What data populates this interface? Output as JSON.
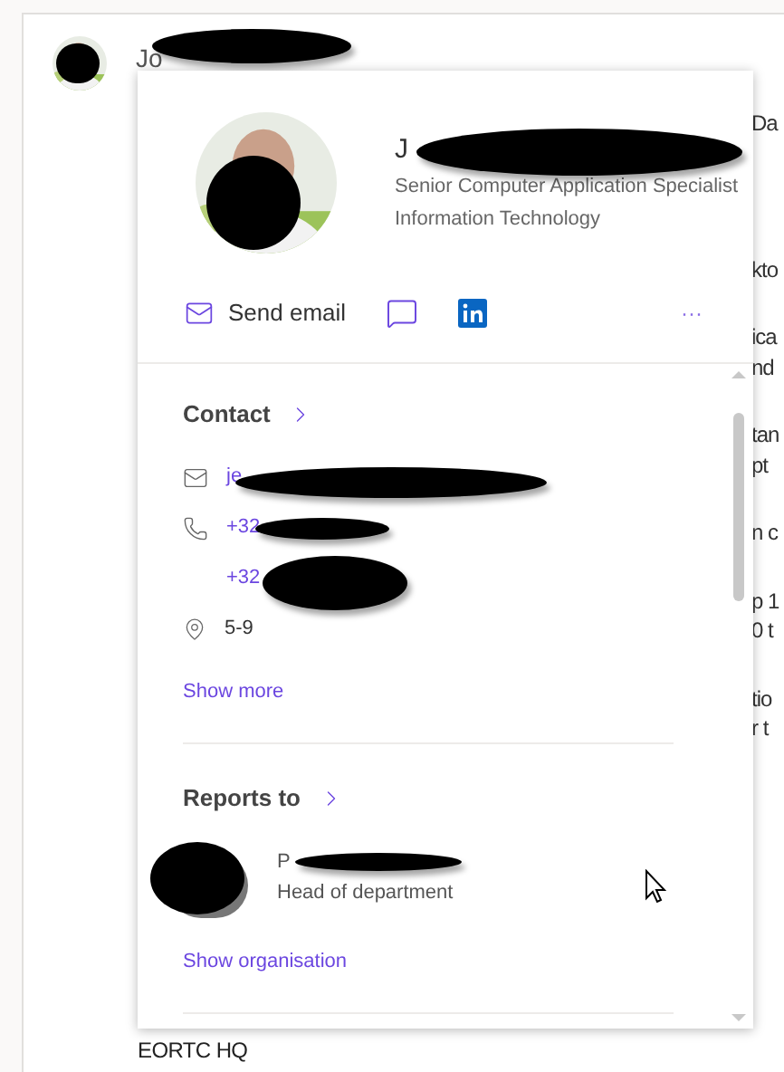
{
  "message": {
    "sender_visible": "Jo",
    "body_lines": [
      [
        "Da"
      ],
      [
        "kto"
      ],
      [
        "ica",
        "nd"
      ],
      [
        "tan",
        "pt"
      ],
      [
        "n c"
      ],
      [
        "p 1",
        "0 t"
      ],
      [
        "tio",
        "r t"
      ]
    ],
    "footer": "EORTC HQ"
  },
  "card": {
    "name_visible": "J",
    "job_title": "Senior Computer Application Specialist",
    "department": "Information Technology",
    "actions": [
      {
        "kind": "email",
        "label": "Send email"
      },
      {
        "kind": "chat"
      },
      {
        "kind": "linkedin"
      },
      {
        "kind": "more",
        "label": "···"
      }
    ],
    "contact": {
      "heading": "Contact",
      "items": [
        {
          "kind": "email",
          "value": "je"
        },
        {
          "kind": "phone",
          "value": "+32"
        },
        {
          "kind": "blank",
          "value": "+32"
        },
        {
          "kind": "location",
          "value": "5-9"
        }
      ],
      "link": "Show more"
    },
    "reports_to": {
      "heading": "Reports to",
      "manager_visible": "P",
      "manager_title": "Head of department",
      "link": "Show organisation"
    }
  }
}
